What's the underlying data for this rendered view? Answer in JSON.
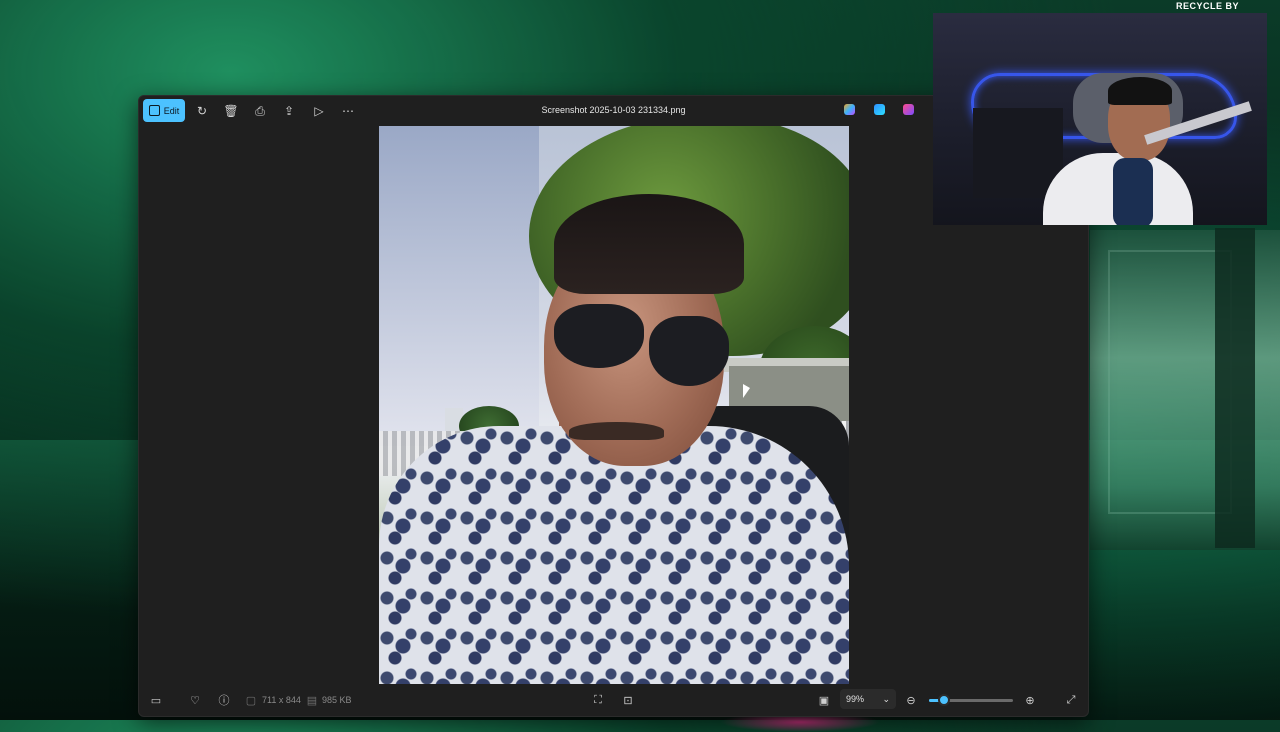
{
  "window": {
    "title": "Screenshot 2025-10-03 231334.png",
    "edit_label": "Edit",
    "toolbar_icons": [
      "rotate-icon",
      "delete-icon",
      "print-icon",
      "share-icon",
      "slideshow-icon",
      "more-icon"
    ],
    "ai_icons": [
      "copilot-icon",
      "designer-icon",
      "clipchamp-icon"
    ]
  },
  "statusbar": {
    "dimensions": "711 x 844",
    "file_size": "985 KB",
    "zoom": "99%",
    "zoom_level_fraction": 0.18
  },
  "overlay": {
    "brand": "RECYCLE BY"
  },
  "colors": {
    "accent": "#4cc2ff",
    "window_bg": "#1f1f1f"
  }
}
